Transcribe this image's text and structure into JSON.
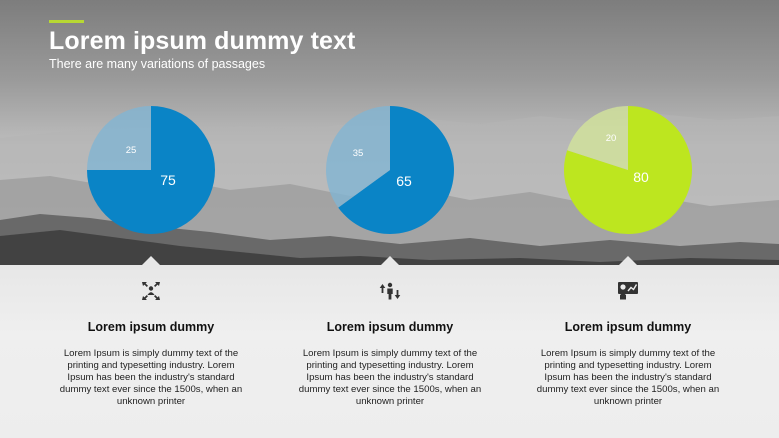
{
  "header": {
    "title": "Lorem ipsum dummy text",
    "subtitle": "There are many variations of passages",
    "accent_color": "#b7d833"
  },
  "chart_data": [
    {
      "type": "pie",
      "slices": [
        {
          "value": 75,
          "label": "75",
          "color": "#0a84c6"
        },
        {
          "value": 25,
          "label": "25",
          "color": "#80b5d3"
        }
      ]
    },
    {
      "type": "pie",
      "slices": [
        {
          "value": 65,
          "label": "65",
          "color": "#0a84c6"
        },
        {
          "value": 35,
          "label": "35",
          "color": "#80b5d3"
        }
      ]
    },
    {
      "type": "pie",
      "slices": [
        {
          "value": 80,
          "label": "80",
          "color": "#bde61f"
        },
        {
          "value": 20,
          "label": "20",
          "color": "#d4e59a"
        }
      ]
    }
  ],
  "columns": [
    {
      "icon": "network-person-icon",
      "heading": "Lorem ipsum dummy",
      "body": "Lorem Ipsum is simply dummy text of the printing and typesetting industry. Lorem Ipsum has been the industry's standard dummy text ever since the 1500s, when an unknown printer"
    },
    {
      "icon": "person-arrows-icon",
      "heading": "Lorem ipsum dummy",
      "body": "Lorem Ipsum is simply dummy text of the printing and typesetting industry. Lorem Ipsum has been the industry's standard dummy text ever since the 1500s, when an unknown printer"
    },
    {
      "icon": "presentation-chart-icon",
      "heading": "Lorem ipsum dummy",
      "body": "Lorem Ipsum is simply dummy text of the printing and typesetting industry. Lorem Ipsum has been the industry's standard dummy text ever since the 1500s, when an unknown printer"
    }
  ]
}
